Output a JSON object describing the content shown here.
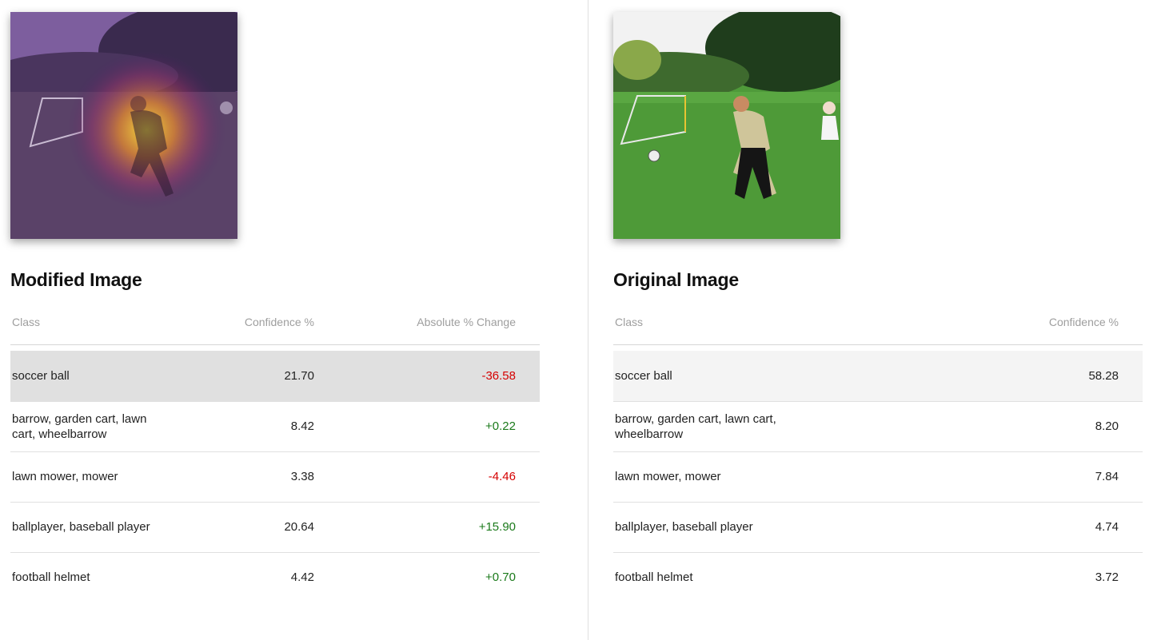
{
  "modified": {
    "title": "Modified Image",
    "headers": {
      "class": "Class",
      "confidence": "Confidence %",
      "change": "Absolute % Change"
    },
    "rows": [
      {
        "class": "soccer ball",
        "confidence": "21.70",
        "change": "-36.58",
        "direction": "negative",
        "selected": true
      },
      {
        "class": "barrow, garden cart, lawn cart, wheelbarrow",
        "confidence": "8.42",
        "change": "+0.22",
        "direction": "positive",
        "selected": false
      },
      {
        "class": "lawn mower, mower",
        "confidence": "3.38",
        "change": "-4.46",
        "direction": "negative",
        "selected": false
      },
      {
        "class": "ballplayer, baseball player",
        "confidence": "20.64",
        "change": "+15.90",
        "direction": "positive",
        "selected": false
      },
      {
        "class": "football helmet",
        "confidence": "4.42",
        "change": "+0.70",
        "direction": "positive",
        "selected": false
      }
    ]
  },
  "original": {
    "title": "Original Image",
    "headers": {
      "class": "Class",
      "confidence": "Confidence %"
    },
    "rows": [
      {
        "class": "soccer ball",
        "confidence": "58.28",
        "selected": true
      },
      {
        "class": "barrow, garden cart, lawn cart, wheelbarrow",
        "confidence": "8.20",
        "selected": false
      },
      {
        "class": "lawn mower, mower",
        "confidence": "7.84",
        "selected": false
      },
      {
        "class": "ballplayer, baseball player",
        "confidence": "4.74",
        "selected": false
      },
      {
        "class": "football helmet",
        "confidence": "3.72",
        "selected": false
      }
    ]
  },
  "colors": {
    "negative": "#d50000",
    "positive": "#1b7a1b",
    "selected_left": "#e0e0e0",
    "selected_right": "#f4f4f4"
  }
}
